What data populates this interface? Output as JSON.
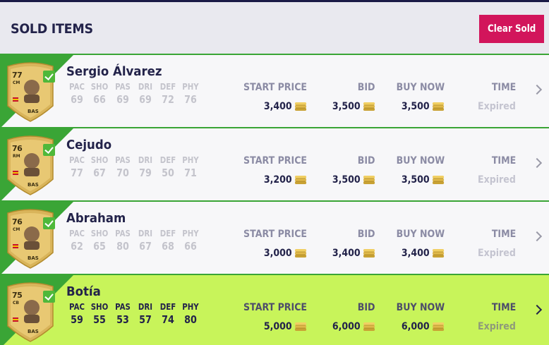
{
  "header": {
    "title": "SOLD ITEMS",
    "clear_label": "Clear Sold"
  },
  "columns": {
    "start": "START PRICE",
    "bid": "BID",
    "buy": "BUY NOW",
    "time": "TIME"
  },
  "stat_labels": [
    "PAC",
    "SHO",
    "PAS",
    "DRI",
    "DEF",
    "PHY"
  ],
  "items": [
    {
      "name": "Sergio Álvarez",
      "rating": "77",
      "position": "CM",
      "chem": "BAS",
      "stats": [
        "69",
        "66",
        "69",
        "69",
        "72",
        "76"
      ],
      "start_price": "3,400",
      "bid": "3,500",
      "buy_now": "3,500",
      "time": "Expired"
    },
    {
      "name": "Cejudo",
      "rating": "76",
      "position": "RM",
      "chem": "BAS",
      "stats": [
        "77",
        "67",
        "70",
        "79",
        "50",
        "71"
      ],
      "start_price": "3,200",
      "bid": "3,500",
      "buy_now": "3,500",
      "time": "Expired"
    },
    {
      "name": "Abraham",
      "rating": "76",
      "position": "CM",
      "chem": "BAS",
      "stats": [
        "62",
        "65",
        "80",
        "67",
        "68",
        "66"
      ],
      "start_price": "3,000",
      "bid": "3,400",
      "buy_now": "3,400",
      "time": "Expired"
    },
    {
      "name": "Botía",
      "rating": "75",
      "position": "CB",
      "chem": "BAS",
      "stats": [
        "59",
        "55",
        "53",
        "57",
        "74",
        "80"
      ],
      "start_price": "5,000",
      "bid": "6,000",
      "buy_now": "6,000",
      "time": "Expired"
    }
  ],
  "colors": {
    "accent": "#d2155b",
    "sold_border": "#3aa536",
    "selected_row": "#c8f45a"
  }
}
